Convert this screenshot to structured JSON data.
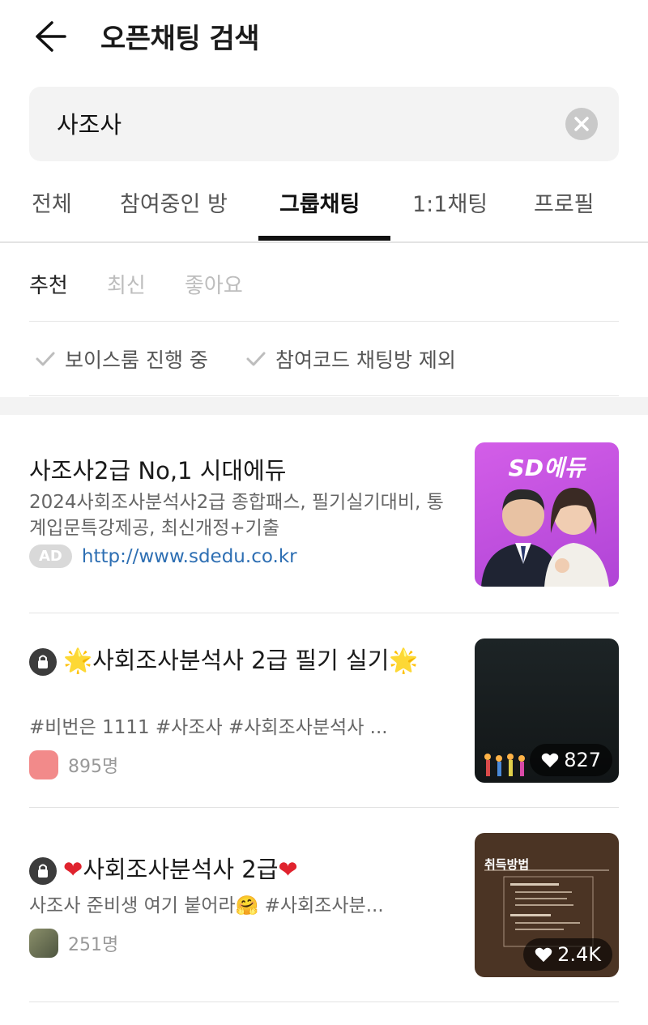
{
  "header": {
    "title": "오픈채팅 검색"
  },
  "search": {
    "value": "사조사"
  },
  "tabs": [
    {
      "label": "전체"
    },
    {
      "label": "참여중인 방"
    },
    {
      "label": "그룹채팅"
    },
    {
      "label": "1:1채팅"
    },
    {
      "label": "프로필"
    }
  ],
  "active_tab": "그룹채팅",
  "sort": [
    {
      "label": "추천"
    },
    {
      "label": "최신"
    },
    {
      "label": "좋아요"
    }
  ],
  "filters": [
    {
      "label": "보이스룸 진행 중"
    },
    {
      "label": "참여코드 채팅방 제외"
    }
  ],
  "results": [
    {
      "title": "사조사2급 No,1 시대에듀",
      "desc": "2024사회조사분석사2급 종합패스, 필기실기대비, 통계입문특강제공, 최신개정+기출",
      "ad_badge": "AD",
      "link": "http://www.sdedu.co.kr",
      "thumb_logo": "SD에듀",
      "thumb_bg": "#c64fe0"
    },
    {
      "title_prefix": "🌟",
      "title": "사회조사분석사 2급 필기 실기",
      "title_suffix": "🌟",
      "desc": "#비번은 1111 #사조사 #사회조사분석사 ...",
      "members": "895명",
      "likes": "827",
      "locked": true
    },
    {
      "title_prefix": "❤",
      "title": "사회조사분석사 2급",
      "title_suffix": "❤",
      "desc": "사조사 준비생 여기 붙어라🤗 #사회조사분...",
      "members": "251명",
      "likes": "2.4K",
      "locked": true,
      "thumb_text": "취득방법"
    }
  ],
  "colors": {
    "accent": "#111111",
    "link": "#2e6fb3",
    "muted": "#bdbdbd"
  }
}
